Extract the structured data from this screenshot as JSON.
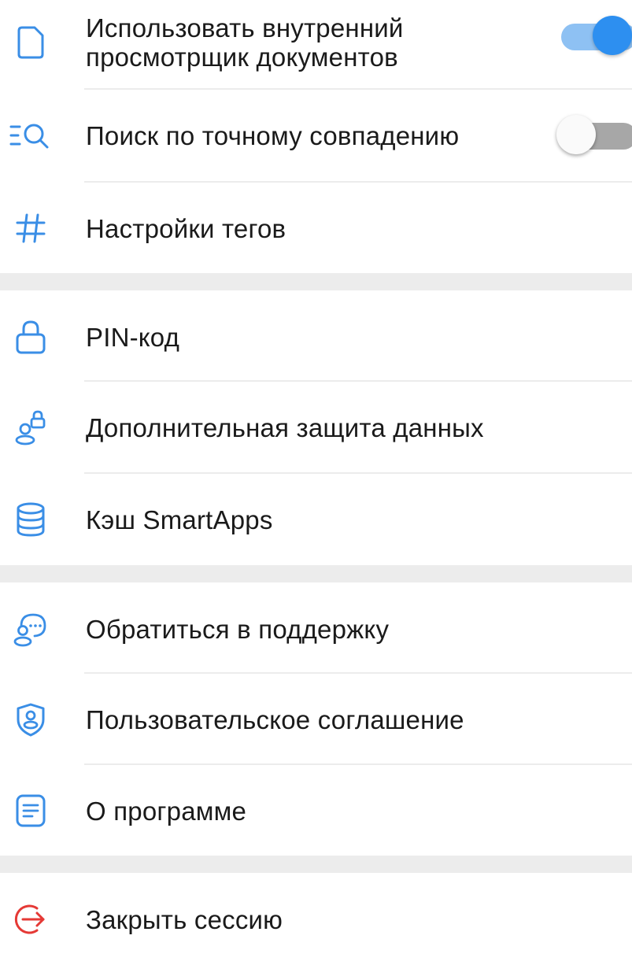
{
  "colors": {
    "accent": "#3a8ee6",
    "danger": "#e53935",
    "divider": "#ececec",
    "toggle_on": "#2d8ff0"
  },
  "settings": {
    "internal_viewer": {
      "label": "Использовать внутренний просмотрщик документов",
      "icon": "document-icon",
      "enabled": true
    },
    "exact_search": {
      "label": "Поиск по точному совпадению",
      "icon": "search-exact-icon",
      "enabled": false
    },
    "tags": {
      "label": "Настройки тегов",
      "icon": "hash-icon"
    },
    "pin": {
      "label": "PIN-код",
      "icon": "lock-icon"
    },
    "extra_protection": {
      "label": "Дополнительная защита данных",
      "icon": "user-lock-icon"
    },
    "smartapps_cache": {
      "label": "Кэш SmartApps",
      "icon": "database-icon"
    },
    "support": {
      "label": "Обратиться в поддержку",
      "icon": "support-chat-icon"
    },
    "user_agreement": {
      "label": "Пользовательское соглашение",
      "icon": "shield-user-icon"
    },
    "about": {
      "label": "О программе",
      "icon": "about-document-icon"
    },
    "logout": {
      "label": "Закрыть сессию",
      "icon": "logout-icon"
    }
  }
}
